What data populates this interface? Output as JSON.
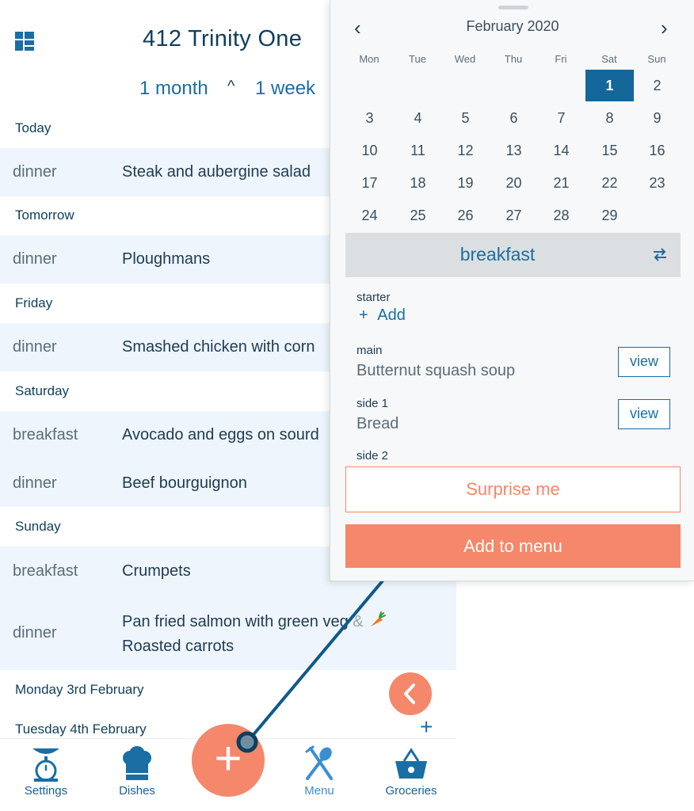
{
  "app": {
    "title": "412 Trinity One",
    "range_month": "1 month",
    "range_caret": "^",
    "range_week": "1 week"
  },
  "days": [
    {
      "label": "Today",
      "meals": [
        {
          "meal": "dinner",
          "dish": "Steak and aubergine salad"
        }
      ]
    },
    {
      "label": "Tomorrow",
      "meals": [
        {
          "meal": "dinner",
          "dish": "Ploughmans"
        }
      ]
    },
    {
      "label": "Friday",
      "meals": [
        {
          "meal": "dinner",
          "dish": "Smashed chicken with corn"
        }
      ]
    },
    {
      "label": "Saturday",
      "meals": [
        {
          "meal": "breakfast",
          "dish": "Avocado and eggs on sourd"
        },
        {
          "meal": "dinner",
          "dish": "Beef bourguignon"
        }
      ]
    },
    {
      "label": "Sunday",
      "meals": [
        {
          "meal": "breakfast",
          "dish": "Crumpets"
        },
        {
          "meal": "dinner",
          "dish_line1": "Pan fried salmon with green veg",
          "ampersand": "&",
          "dish_line2": "Roasted carrots",
          "dish_icon": "carrot-icon"
        }
      ]
    },
    {
      "label": "Monday 3rd February",
      "meals": []
    },
    {
      "label": "Tuesday 4th February",
      "meals": [],
      "add": "+"
    }
  ],
  "nav": {
    "settings": "Settings",
    "dishes": "Dishes",
    "menu": "Menu",
    "groceries": "Groceries",
    "fab": "+"
  },
  "calendar": {
    "month_title": "February 2020",
    "prev": "‹",
    "next": "›",
    "weekdays": [
      "Mon",
      "Tue",
      "Wed",
      "Thu",
      "Fri",
      "Sat",
      "Sun"
    ],
    "days": [
      "1",
      "2",
      "3",
      "4",
      "5",
      "6",
      "7",
      "8",
      "9",
      "10",
      "11",
      "12",
      "13",
      "14",
      "15",
      "16",
      "17",
      "18",
      "19",
      "20",
      "21",
      "22",
      "23",
      "24",
      "25",
      "26",
      "27",
      "28",
      "29"
    ],
    "selected_day": "1",
    "first_weekday_index": 5
  },
  "meal_panel": {
    "meal_name": "breakfast",
    "swap_icon": "swap-arrows-icon",
    "courses": [
      {
        "label": "starter",
        "add": "Add",
        "add_symbol": "+"
      },
      {
        "label": "main",
        "value": "Butternut squash soup",
        "action": "view"
      },
      {
        "label": "side 1",
        "value": "Bread",
        "action": "view"
      },
      {
        "label": "side 2"
      }
    ],
    "surprise_label": "Surprise me",
    "add_to_menu_label": "Add to menu"
  },
  "colors": {
    "brand_blue": "#1a6ea3",
    "accent_orange": "#f5876a",
    "row_bg": "#eef5fc",
    "selected_day_bg": "#14669b"
  }
}
